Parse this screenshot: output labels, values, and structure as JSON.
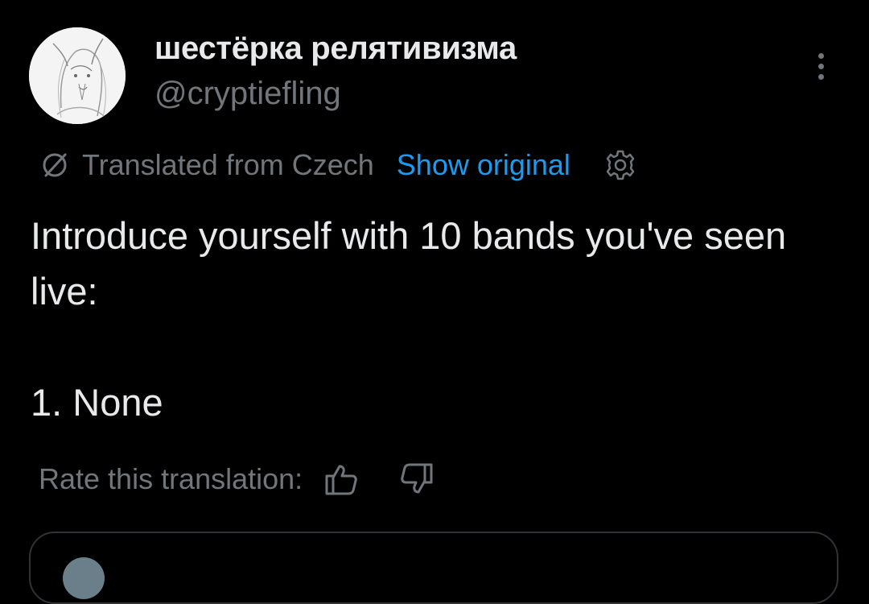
{
  "tweet": {
    "display_name": "шестёрка релятивизма",
    "handle": "@cryptiefling",
    "body": "Introduce yourself with 10 bands you've seen live:\n\n1. None"
  },
  "translation": {
    "translated_from": "Translated from Czech",
    "show_original": "Show original",
    "rate_label": "Rate this translation:"
  },
  "icons": {
    "more": "more-vertical-icon",
    "translate": "translate-icon",
    "settings": "gear-icon",
    "thumbs_up": "thumbs-up-icon",
    "thumbs_down": "thumbs-down-icon"
  },
  "colors": {
    "background": "#000000",
    "text_primary": "#e7e9ea",
    "text_secondary": "#71767b",
    "link": "#1d9bf0",
    "border": "#2f3336"
  }
}
